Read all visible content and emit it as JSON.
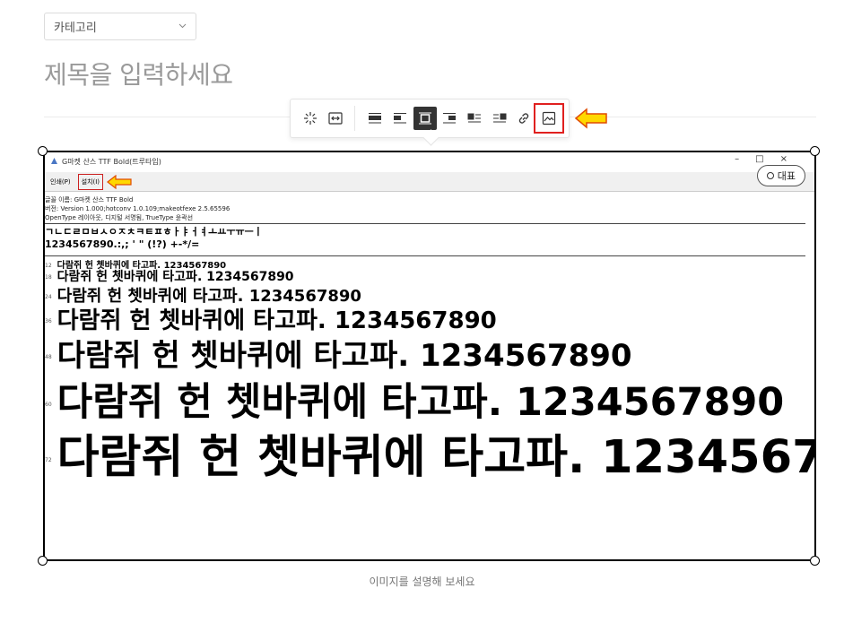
{
  "category": {
    "label": "카테고리"
  },
  "title": {
    "placeholder": "제목을 입력하세요"
  },
  "toolbar": {
    "items": [
      "effect-icon",
      "fit-width-icon",
      "align-full-icon",
      "align-left-icon",
      "align-center-icon",
      "align-right-icon",
      "wrap-left-icon",
      "wrap-right-icon",
      "link-icon",
      "image-icon"
    ],
    "active": "align-center-icon",
    "highlight": "image-icon"
  },
  "screenshot": {
    "window_title": "G마켓 산스 TTF Bold(트루타입)",
    "print_button": "인쇄(P)",
    "install_button": "설치(I)",
    "meta_lines": [
      "글꼴 이름: G마켓 산스 TTF Bold",
      "버전: Version 1.000;hotconv 1.0.109;makeotfexe 2.5.65596",
      "OpenType 레이아웃, 디지털 서명됨, TrueType 윤곽선"
    ],
    "jamo_line": "ㄱㄴㄷㄹㅁㅂㅅㅇㅈㅊㅋㅌㅍㅎㅏㅑㅓㅕㅗㅛㅜㅠㅡㅣ",
    "symbol_line": "1234567890.:,; ' \" (!?) +-*/=",
    "sample_text": "다람쥐 헌 쳇바퀴에 타고파. 1234567890",
    "sizes": [
      "12",
      "18",
      "24",
      "36",
      "48",
      "60",
      "72"
    ]
  },
  "represent_button": "대표",
  "caption": {
    "placeholder": "이미지를 설명해 보세요"
  },
  "colors": {
    "annotation_red": "#e0201f",
    "arrow_yellow": "#ffd800",
    "arrow_orange": "#ff8c00"
  }
}
